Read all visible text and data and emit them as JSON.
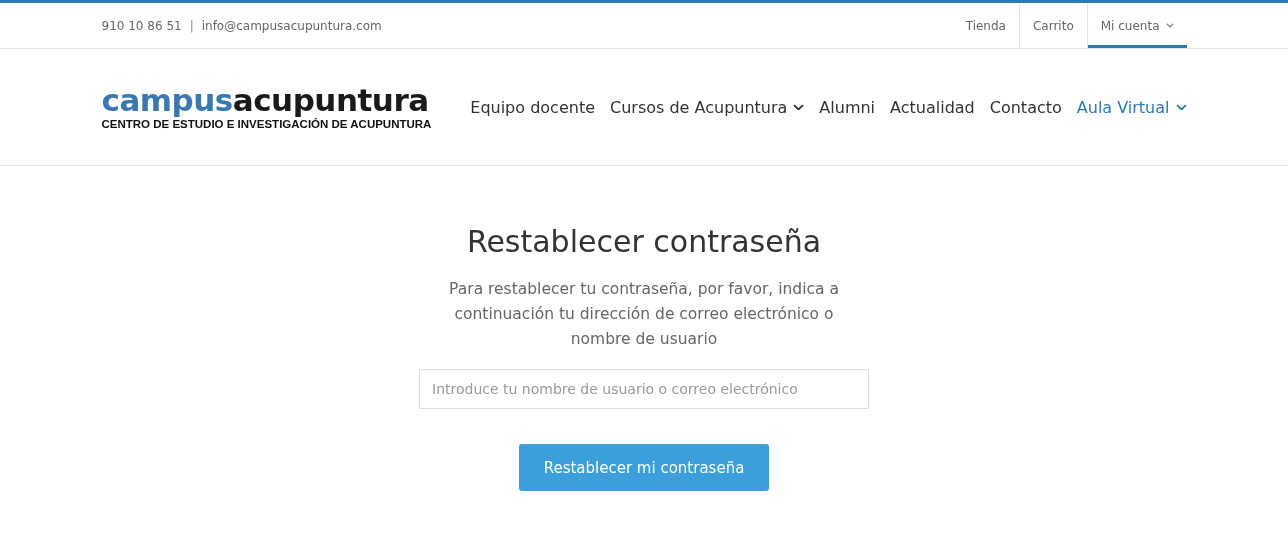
{
  "top_bar": {
    "phone": "910 10 86 51",
    "separator": "|",
    "email": "info@campusacupuntura.com",
    "links": [
      {
        "label": "Tienda",
        "selected": false,
        "has_dropdown": false
      },
      {
        "label": "Carrito",
        "selected": false,
        "has_dropdown": false
      },
      {
        "label": "Mi cuenta",
        "selected": true,
        "has_dropdown": true
      }
    ]
  },
  "logo": {
    "wordmark": [
      {
        "text": "campus",
        "color": "#3a78b4"
      },
      {
        "text": "acupuntura",
        "color": "#1a1a1a"
      }
    ],
    "tagline": "CENTRO DE ESTUDIO E INVESTIGACIÓN DE ACUPUNTURA"
  },
  "nav": [
    {
      "label": "Equipo docente",
      "selected": false,
      "has_dropdown": false
    },
    {
      "label": "Cursos de Acupuntura",
      "selected": false,
      "has_dropdown": true
    },
    {
      "label": "Alumni",
      "selected": false,
      "has_dropdown": false
    },
    {
      "label": "Actualidad",
      "selected": false,
      "has_dropdown": false
    },
    {
      "label": "Contacto",
      "selected": false,
      "has_dropdown": false
    },
    {
      "label": "Aula Virtual",
      "selected": true,
      "has_dropdown": true
    }
  ],
  "form": {
    "title": "Restablecer contraseña",
    "description": "Para restablecer tu contraseña, por favor, indica a continuación tu dirección de correo electrónico o nombre de usuario",
    "field": {
      "placeholder": "Introduce tu nombre de usuario o correo electrónico"
    },
    "button": "Restablecer mi contraseña"
  }
}
